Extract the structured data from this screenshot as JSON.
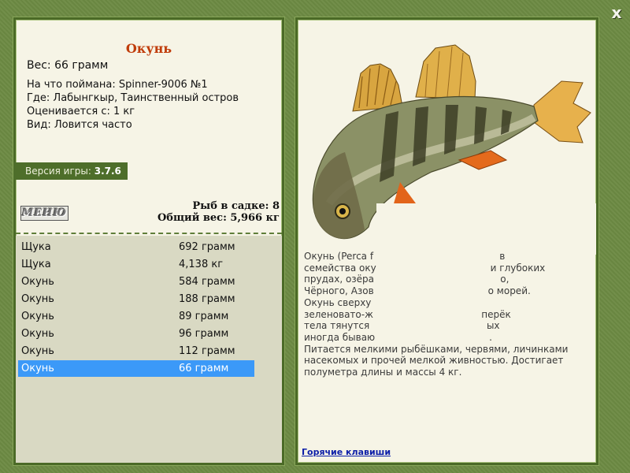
{
  "window": {
    "close_label": "x"
  },
  "fish": {
    "name": "Окунь",
    "weight_line": "Вес: 66 грамм",
    "details": [
      "На что поймана: Spinner-9006 №1",
      "Где: Лабынгкыр, Таинственный остров",
      "Оценивается с: 1 кг",
      "Вид: Ловится часто"
    ]
  },
  "version": {
    "label": "Версия игры:",
    "value": "3.7.6"
  },
  "menu_button": "МЕНЮ",
  "keepnet": {
    "count_line": "Рыб в садке: 8",
    "total_line": "Общий вес: 5,966 кг"
  },
  "catches": [
    {
      "name": "Щука",
      "weight": "692 грамм"
    },
    {
      "name": "Щука",
      "weight": "4,138 кг"
    },
    {
      "name": "Окунь",
      "weight": "584 грамм"
    },
    {
      "name": "Окунь",
      "weight": "188 грамм"
    },
    {
      "name": "Окунь",
      "weight": "89 грамм"
    },
    {
      "name": "Окунь",
      "weight": "96 грамм"
    },
    {
      "name": "Окунь",
      "weight": "112 грамм"
    },
    {
      "name": "Окунь",
      "weight": "66 грамм",
      "selected": true
    }
  ],
  "description_lines": [
    "Окунь (Perca f                                          в",
    "семейства оку                                      и глубоких",
    "прудах, озёра                                          о,",
    "Чёрного, Азов                                      о морей.",
    "Окунь сверху",
    "зеленовато-ж                                    перёк",
    "тела тянутся                                       ых",
    "иногда бываю                                      .",
    "Питается мелкими рыбёшками, червями, личинками",
    "насекомых и прочей мелкой живностью. Достигает",
    "полуметра длины и массы 4 кг."
  ],
  "hotkeys_link": "Горячие клавиши",
  "colors": {
    "frame": "#6c8a43",
    "panel": "#f6f4e6",
    "selection": "#3b99f8",
    "title": "#c03c0a"
  }
}
